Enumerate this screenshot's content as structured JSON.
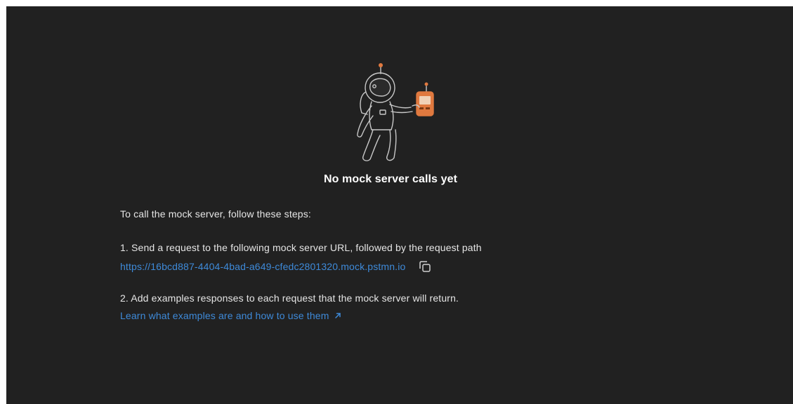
{
  "empty_state": {
    "title": "No mock server calls yet",
    "intro": "To call the mock server, follow these steps:",
    "illustration": "astronaut-with-walkie-talkie"
  },
  "steps": [
    {
      "text": "1. Send a request to the following mock server URL, followed by the request path",
      "link_text": "https://16bcd887-4404-4bad-a649-cfedc2801320.mock.pstmn.io",
      "action_icon": "copy-icon"
    },
    {
      "text": "2. Add examples responses to each request that the mock server will return.",
      "link_text": "Learn what examples are and how to use them",
      "action_icon": "external-link-arrow-icon"
    }
  ],
  "colors": {
    "background": "#212121",
    "text": "#e6e6e6",
    "title": "#ffffff",
    "link": "#3e8ad9",
    "accent_orange": "#e0793f"
  }
}
